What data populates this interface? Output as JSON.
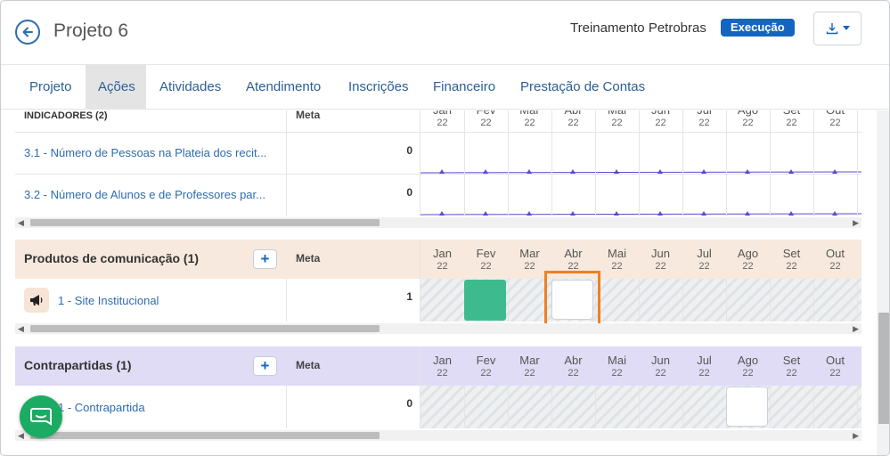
{
  "header": {
    "title": "Projeto 6",
    "organization": "Treinamento Petrobras",
    "status_badge": "Execução"
  },
  "tabs": [
    {
      "label": "Projeto"
    },
    {
      "label": "Ações"
    },
    {
      "label": "Atividades"
    },
    {
      "label": "Atendimento"
    },
    {
      "label": "Inscrições"
    },
    {
      "label": "Financeiro"
    },
    {
      "label": "Prestação de Contas"
    }
  ],
  "active_tab": "Ações",
  "months": [
    "Jan",
    "Fev",
    "Mar",
    "Abr",
    "Mai",
    "Jun",
    "Jul",
    "Ago",
    "Set",
    "Out"
  ],
  "indicadores_header_months": [
    "Jan",
    "Fev",
    "Mar",
    "Abr",
    "Mai",
    "Jun",
    "Jul",
    "Ago",
    "Set",
    "Out"
  ],
  "year": "22",
  "indicadores": {
    "title": "INDICADORES (2)",
    "meta_label": "Meta",
    "rows": [
      {
        "label": "3.1 - Número de Pessoas na Plateia dos recit...",
        "meta": "0"
      },
      {
        "label": "3.2 - Número de Alunos e de Professores par...",
        "meta": "0"
      }
    ]
  },
  "produtos": {
    "title": "Produtos de comunicação (1)",
    "add_label": "+",
    "meta_label": "Meta",
    "rows": [
      {
        "label": "1 - Site Institucional",
        "meta": "1",
        "icon": "megaphone-icon"
      }
    ]
  },
  "contrapartidas": {
    "title": "Contrapartidas (1)",
    "add_label": "+",
    "meta_label": "Meta",
    "rows": [
      {
        "label": "1 - Contrapartida",
        "meta": "0"
      }
    ]
  },
  "colors": {
    "primary": "#1565c0",
    "produtos_bg": "#f7e9dd",
    "contrapartidas_bg": "#e0dcf5",
    "filled_cell": "#3dbb8f",
    "highlight": "#f07f22",
    "chat": "#1cab62",
    "line": "#5a4bcf"
  }
}
